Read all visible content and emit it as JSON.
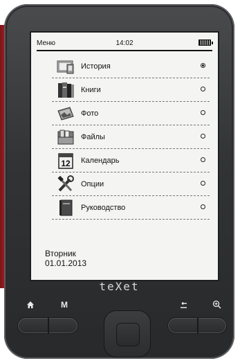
{
  "status": {
    "title": "Меню",
    "time": "14:02"
  },
  "menu": {
    "items": [
      {
        "label": "История",
        "icon": "history-icon",
        "selected": true
      },
      {
        "label": "Книги",
        "icon": "books-icon",
        "selected": false
      },
      {
        "label": "Фото",
        "icon": "photo-icon",
        "selected": false
      },
      {
        "label": "Файлы",
        "icon": "files-icon",
        "selected": false
      },
      {
        "label": "Календарь",
        "icon": "calendar-icon",
        "selected": false,
        "icon_text": "12"
      },
      {
        "label": "Опции",
        "icon": "tools-icon",
        "selected": false
      },
      {
        "label": "Руководство",
        "icon": "manual-icon",
        "selected": false
      }
    ]
  },
  "date": {
    "weekday": "Вторник",
    "date": "01.01.2013"
  },
  "device": {
    "brand": "teXet"
  },
  "buttons": {
    "menu_label": "M"
  }
}
